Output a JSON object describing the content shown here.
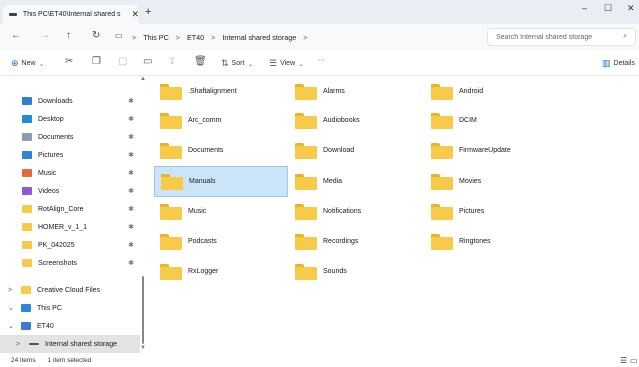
{
  "window": {
    "tab_title": "This PC\\ET40\\Internal shared s",
    "tab_close": "✕",
    "new_tab": "+",
    "minimize": "–",
    "maximize": "☐",
    "close": "✕"
  },
  "nav": {
    "back": "←",
    "forward": "→",
    "up": "↑",
    "refresh": "↻",
    "breadcrumb": [
      "This PC",
      "ET40",
      "Internal shared storage"
    ],
    "separator": ">",
    "search_placeholder": "Search Internal shared storage"
  },
  "commands": {
    "new": "New",
    "sort": "Sort",
    "view": "View",
    "more": "···",
    "details": "Details"
  },
  "sidebar": {
    "quick_access": [
      {
        "label": "Downloads",
        "icon": "download-icon",
        "color": "#2e7fd1"
      },
      {
        "label": "Desktop",
        "icon": "desktop-icon",
        "color": "#1f8ad8"
      },
      {
        "label": "Documents",
        "icon": "documents-icon",
        "color": "#8a9bb2"
      },
      {
        "label": "Pictures",
        "icon": "pictures-icon",
        "color": "#2a86d6"
      },
      {
        "label": "Music",
        "icon": "music-icon",
        "color": "#e8683a"
      },
      {
        "label": "Videos",
        "icon": "videos-icon",
        "color": "#8a5ad8"
      },
      {
        "label": "RotAlign_Core",
        "icon": "folder-icon",
        "color": "#f7ca4a"
      },
      {
        "label": "HOMER_v_1_1",
        "icon": "folder-icon",
        "color": "#f7ca4a"
      },
      {
        "label": "PK_042025",
        "icon": "folder-icon",
        "color": "#f7ca4a"
      },
      {
        "label": "Screenshots",
        "icon": "folder-icon",
        "color": "#f7ca4a"
      }
    ],
    "tree": [
      {
        "label": "Creative Cloud Files",
        "expander": ">",
        "icon": "cloud-folder-icon",
        "color": "#f7ca4a"
      },
      {
        "label": "This PC",
        "expander": "⌄",
        "icon": "pc-icon",
        "color": "#2a86d6"
      },
      {
        "label": "ET40",
        "expander": "⌄",
        "icon": "phone-icon",
        "color": "#3a7bd5"
      },
      {
        "label": "Internal shared storage",
        "expander": ">",
        "icon": "drive-icon",
        "color": "#555555"
      }
    ]
  },
  "folders": [
    ".Shaftalignment",
    "Alarms",
    "Android",
    "Arc_comm",
    "Audiobooks",
    "DCIM",
    "Documents",
    "Download",
    "FirmwareUpdate",
    "Manuals",
    "Media",
    "Movies",
    "Music",
    "Notifications",
    "Pictures",
    "Podcasts",
    "Recordings",
    "Ringtones",
    "RxLogger",
    "Sounds"
  ],
  "status": {
    "count": "24 items",
    "selection": "1 item selected"
  }
}
